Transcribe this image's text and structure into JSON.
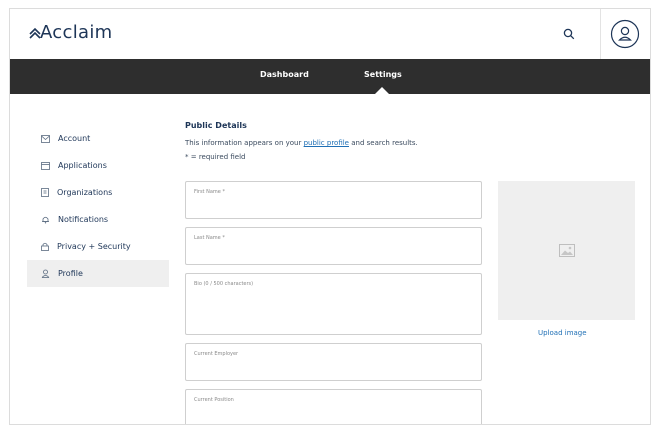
{
  "app": {
    "name": "Acclaim"
  },
  "nav": {
    "tabs": [
      {
        "label": "Dashboard"
      },
      {
        "label": "Settings",
        "active": true
      }
    ]
  },
  "sidebar": {
    "items": [
      {
        "label": "Account",
        "icon": "envelope-icon"
      },
      {
        "label": "Applications",
        "icon": "window-icon"
      },
      {
        "label": "Organizations",
        "icon": "building-icon"
      },
      {
        "label": "Notifications",
        "icon": "bell-icon"
      },
      {
        "label": "Privacy + Security",
        "icon": "lock-icon"
      },
      {
        "label": "Profile",
        "icon": "profile-icon",
        "active": true
      }
    ]
  },
  "main": {
    "title": "Public Details",
    "desc_prefix": "This information appears on your ",
    "desc_link": "public profile",
    "desc_suffix": " and search results.",
    "required_note": "* = required field",
    "fields": [
      {
        "placeholder": "First Name *"
      },
      {
        "placeholder": "Last Name *"
      },
      {
        "placeholder": "Bio (0 / 500 characters)"
      },
      {
        "placeholder": "Current Employer"
      },
      {
        "placeholder": "Current Position"
      }
    ],
    "upload_label": "Upload image"
  },
  "colors": {
    "brand": "#1d3557",
    "navbar": "#2e2e2e",
    "link": "#1f6fb5",
    "active_bg": "#efefef"
  }
}
